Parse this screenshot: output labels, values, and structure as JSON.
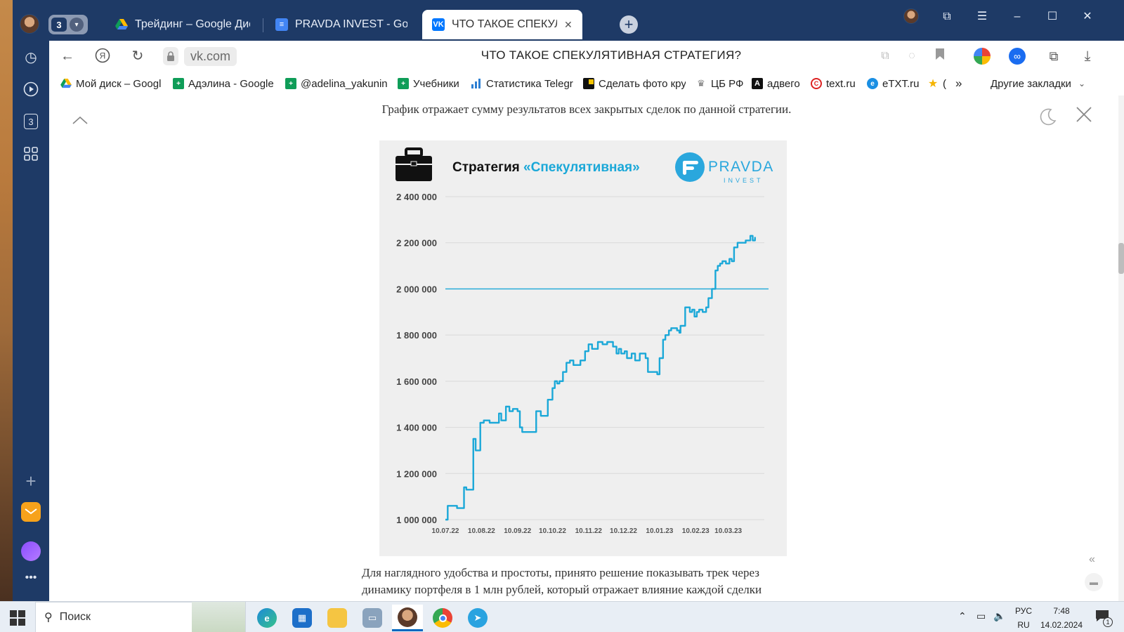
{
  "tabs": {
    "group_count": "3",
    "items": [
      {
        "label": "Трейдинг – Google Диск",
        "favicon": "google-drive-icon"
      },
      {
        "label": "PRAVDA INVEST - Google",
        "favicon": "google-docs-icon"
      },
      {
        "label": "ЧТО ТАКОЕ СПЕКУЛЯТИ",
        "favicon": "vk-icon",
        "active": true
      }
    ]
  },
  "toolbar": {
    "domain": "vk.com",
    "page_title": "ЧТО ТАКОЕ СПЕКУЛЯТИВНАЯ СТРАТЕГИЯ?"
  },
  "sidepanel": {
    "badge_count": "3"
  },
  "bookmarks": {
    "items": [
      {
        "label": "Мой диск – Googl",
        "icon": "google-drive-icon"
      },
      {
        "label": "Адэлина - Google",
        "icon": "google-sheets-icon"
      },
      {
        "label": "@adelina_yakunina",
        "icon": "google-sheets-icon"
      },
      {
        "label": "Учебники",
        "icon": "google-sheets-icon"
      },
      {
        "label": "Статистика Telegra",
        "icon": "stats-icon"
      },
      {
        "label": "Сделать фото кру",
        "icon": "camera-icon"
      },
      {
        "label": "ЦБ РФ",
        "icon": "cbrf-icon"
      },
      {
        "label": "адвего",
        "icon": "advego-icon"
      },
      {
        "label": "text.ru",
        "icon": "textru-icon"
      },
      {
        "label": "eTXT.ru",
        "icon": "etxt-icon"
      },
      {
        "label": "(",
        "icon": "star-icon"
      }
    ],
    "more": "»",
    "other": "Другие закладки"
  },
  "content": {
    "caption": "График отражает сумму результатов всех закрытых сделок по данной стратегии.",
    "body_text": "Для наглядного удобства и простоты, принято решение показывать трек через динамику портфеля в 1 млн рублей, который отражает влияние каждой сделки"
  },
  "chart_data": {
    "type": "line",
    "title_prefix": "Стратегия ",
    "title_highlight": "«Спекулятивная»",
    "brand": "PRAVDA",
    "brand_sub": "INVEST",
    "ylim": [
      1000000,
      2400000
    ],
    "yticks": [
      {
        "value": 1000000,
        "label": "1 000 000"
      },
      {
        "value": 1200000,
        "label": "1 200 000"
      },
      {
        "value": 1400000,
        "label": "1 400 000"
      },
      {
        "value": 1600000,
        "label": "1 600 000"
      },
      {
        "value": 1800000,
        "label": "1 800 000"
      },
      {
        "value": 2000000,
        "label": "2 000 000"
      },
      {
        "value": 2200000,
        "label": "2 200 000"
      },
      {
        "value": 2400000,
        "label": "2 400 000"
      }
    ],
    "xticks": [
      {
        "value": 0,
        "label": "10.07.22"
      },
      {
        "value": 31,
        "label": "10.08.22"
      },
      {
        "value": 62,
        "label": "10.09.22"
      },
      {
        "value": 92,
        "label": "10.10.22"
      },
      {
        "value": 123,
        "label": "10.11.22"
      },
      {
        "value": 153,
        "label": "10.12.22"
      },
      {
        "value": 184,
        "label": "10.01.23"
      },
      {
        "value": 215,
        "label": "10.02.23"
      },
      {
        "value": 243,
        "label": "10.03.23"
      }
    ],
    "xlim": [
      0,
      274
    ],
    "reference_line": 2000000,
    "x": [
      0,
      2,
      10,
      16,
      18,
      24,
      26,
      30,
      33,
      38,
      46,
      48,
      52,
      55,
      58,
      62,
      64,
      66,
      74,
      78,
      82,
      88,
      92,
      94,
      96,
      98,
      101,
      104,
      107,
      110,
      116,
      120,
      123,
      126,
      131,
      135,
      139,
      144,
      147,
      149,
      151,
      154,
      156,
      160,
      163,
      167,
      172,
      174,
      176,
      182,
      184,
      187,
      189,
      192,
      194,
      199,
      201,
      202,
      206,
      210,
      212,
      214,
      216,
      218,
      221,
      224,
      226,
      229,
      232,
      234,
      236,
      238,
      241,
      244,
      246,
      248,
      251,
      254,
      258,
      262,
      264,
      266
    ],
    "y": [
      1000000,
      1060000,
      1050000,
      1140000,
      1130000,
      1350000,
      1300000,
      1420000,
      1430000,
      1420000,
      1460000,
      1430000,
      1490000,
      1470000,
      1480000,
      1470000,
      1400000,
      1380000,
      1380000,
      1470000,
      1450000,
      1520000,
      1570000,
      1600000,
      1590000,
      1600000,
      1640000,
      1680000,
      1690000,
      1670000,
      1690000,
      1730000,
      1760000,
      1740000,
      1770000,
      1760000,
      1770000,
      1750000,
      1720000,
      1740000,
      1720000,
      1730000,
      1700000,
      1720000,
      1690000,
      1720000,
      1700000,
      1640000,
      1640000,
      1630000,
      1700000,
      1780000,
      1800000,
      1820000,
      1830000,
      1820000,
      1810000,
      1840000,
      1920000,
      1900000,
      1910000,
      1880000,
      1900000,
      1910000,
      1900000,
      1920000,
      1960000,
      2000000,
      2080000,
      2100000,
      2110000,
      2120000,
      2110000,
      2130000,
      2120000,
      2180000,
      2200000,
      2200000,
      2210000,
      2230000,
      2210000,
      2225000
    ]
  },
  "taskbar": {
    "search_label": "Поиск",
    "lang_top": "РУС",
    "lang_bottom": "RU",
    "time": "7:48",
    "date": "14.02.2024",
    "notif_count": "1"
  },
  "colors": {
    "frame": "#1e3a66",
    "accent": "#1ba8d8",
    "line": "#1ba8d8"
  }
}
